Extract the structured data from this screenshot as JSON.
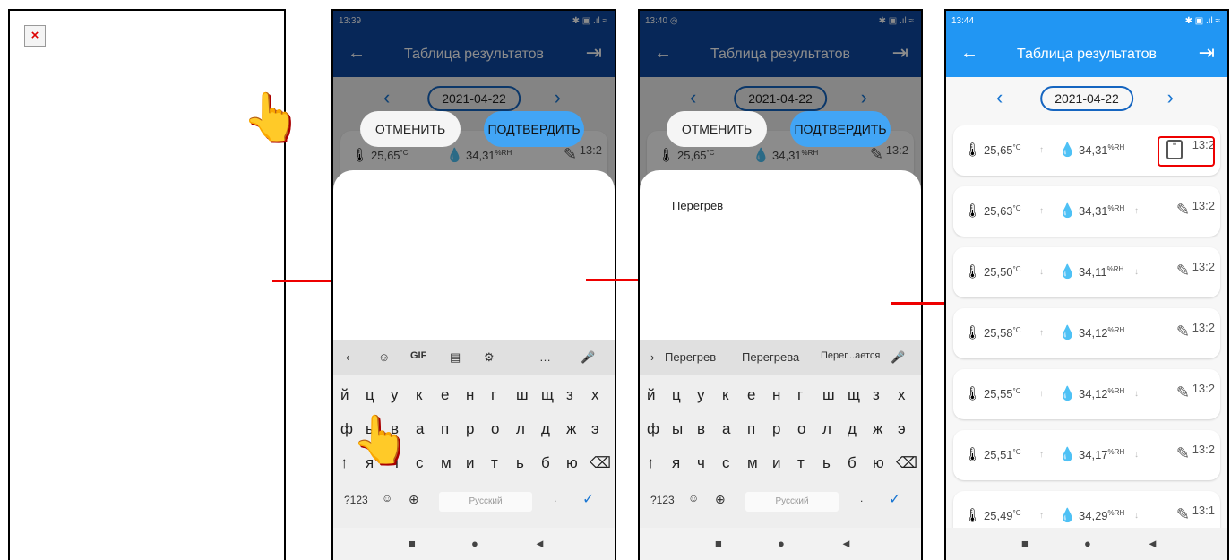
{
  "panel1": {
    "broken_icon": "×"
  },
  "panel2": {
    "time": "13:39",
    "status_icons": "✱ ▣ .ıl ≈",
    "title": "Таблица результатов",
    "date": "2021-04-22",
    "cancel_label": "ОТМЕНИТЬ",
    "confirm_label": "ПОДТВЕРДИТЬ",
    "row": {
      "temp": "25,65",
      "temp_unit": "°C",
      "hum": "34,31",
      "hum_unit": "%RH",
      "time": "13:2"
    },
    "kb_toolbar": [
      "‹",
      "☺",
      "GIF",
      "▤",
      "⚙",
      "…",
      "🎤"
    ],
    "kb_row1": [
      "й",
      "ц",
      "у",
      "к",
      "е",
      "н",
      "г",
      "ш",
      "щ",
      "з",
      "х"
    ],
    "kb_row2": [
      "ф",
      "ы",
      "в",
      "а",
      "п",
      "р",
      "о",
      "л",
      "д",
      "ж",
      "э"
    ],
    "kb_row3": [
      "↑",
      "я",
      "ч",
      "с",
      "м",
      "и",
      "т",
      "ь",
      "б",
      "ю",
      "⌫"
    ],
    "kb_symbols": "?123",
    "kb_emoji": "☺",
    "kb_globe": "⊕",
    "kb_space": "Русский",
    "kb_dot": ".",
    "kb_enter": "✓"
  },
  "panel3": {
    "time": "13:40",
    "status_extra": "◎",
    "status_icons": "✱ ▣ .ıl ≈",
    "title": "Таблица результатов",
    "date": "2021-04-22",
    "cancel_label": "ОТМЕНИТЬ",
    "confirm_label": "ПОДТВЕРДИТЬ",
    "sheet_text": "Перегрев",
    "suggestions": [
      "›",
      "Перегрев",
      "Перегрева",
      "Перег...ается",
      "🎤"
    ]
  },
  "panel4": {
    "time": "13:44",
    "status_icons": "✱ ▣ .ıl ≈",
    "title": "Таблица результатов",
    "date": "2021-04-22",
    "rows": [
      {
        "temp": "25,65",
        "hum": "34,31",
        "time": "13:2"
      },
      {
        "temp": "25,63",
        "hum": "34,31",
        "time": "13:2"
      },
      {
        "temp": "25,50",
        "hum": "34,11",
        "time": "13:2"
      },
      {
        "temp": "25,58",
        "hum": "34,12",
        "time": "13:2"
      },
      {
        "temp": "25,55",
        "hum": "34,12",
        "time": "13:2"
      },
      {
        "temp": "25,51",
        "hum": "34,17",
        "time": "13:2"
      },
      {
        "temp": "25,49",
        "hum": "34,29",
        "time": "13:1"
      }
    ],
    "temp_unit": "°C",
    "hum_unit": "%RH"
  },
  "nav": [
    "■",
    "●",
    "◄"
  ],
  "colors": {
    "appbar": "#0d47a1",
    "accent": "#42a5f5",
    "arrow": "#ee0000",
    "highlight": "#ee0000"
  }
}
